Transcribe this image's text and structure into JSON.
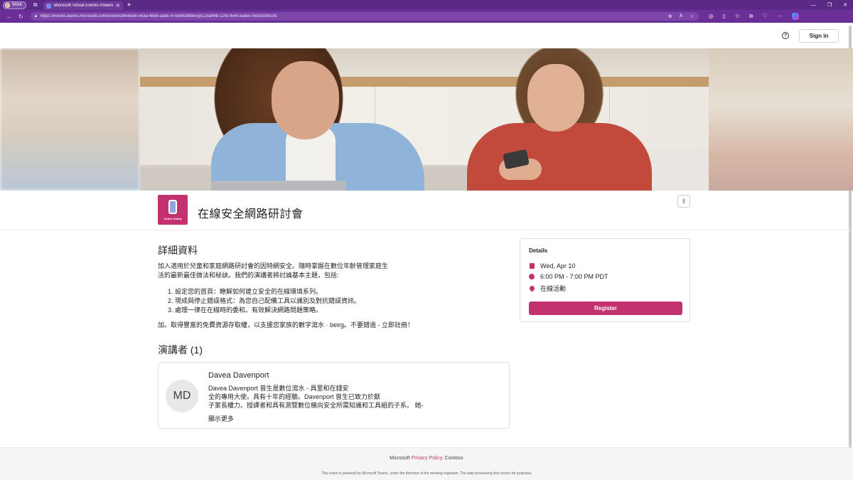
{
  "browser": {
    "profile_label": "Work",
    "tab_title": "Microsoft Virtual Events Powered",
    "url": "https://events.teams.microsoft.com/event/c8fe4a56-563a-4895-addc-47bc6fcd8be5@125af4fb-12f8-4540-babe-05b3c0dfccfd"
  },
  "header": {
    "sign_in_label": "Sign in"
  },
  "event": {
    "logo_text": "Online Safety",
    "title": "在線安全網路研討會"
  },
  "details_section": {
    "heading": "詳細資料",
    "intro_line1": "加入適用於兒童和家庭網路研討會的因特網安全。隨時掌握在數位年齡管理家庭生",
    "intro_line2": "活的最新最佳做法和秘訣。我們的演講者將討論基本主題，包括:",
    "list": [
      "1. 設定您的首頁：瞭解如何建立安全的在線環境系列。",
      "2. 現成與停止錯誤格式：為您自己配備工具以識別及對抗錯誤資訊。",
      "3. 處理一律在在線時的委和。有效解決網路問題策略。"
    ],
    "closing": "加。取得豐富的免費資源存取權，以支援您家族的數字瀉水 · beirg。不要錯過 - 立即註冊！"
  },
  "details_card": {
    "title": "Details",
    "date": "Wed, Apr 10",
    "time": "6:00 PM - 7:00 PM PDT",
    "location": "在線活動",
    "register_label": "Register"
  },
  "speakers": {
    "heading": "演講者 (1)",
    "items": [
      {
        "initials": "MD",
        "name": "Davea Davenport",
        "bio_line1": "Davea Davenport 曾生是數位瀉水 - 具里和在錢安",
        "bio_line2": "全的專用大使。具有十年的經驗。Davenport 曾生已致力於獻",
        "bio_line3": "子家長權力。授課者和具有測覽數位橫向安全所需知識和工具組的子系。 她-",
        "show_more": "顯示更多"
      }
    ]
  },
  "footer": {
    "brand": "Microsoft",
    "privacy": "Privacy Policy",
    "org": "Contoso",
    "note": "This event is powered by Microsoft Teams, under the direction of the meeting organizer. The data processing that occurs for purposes"
  },
  "colors": {
    "accent": "#c4316f",
    "browser_frame": "#5b2a86"
  }
}
